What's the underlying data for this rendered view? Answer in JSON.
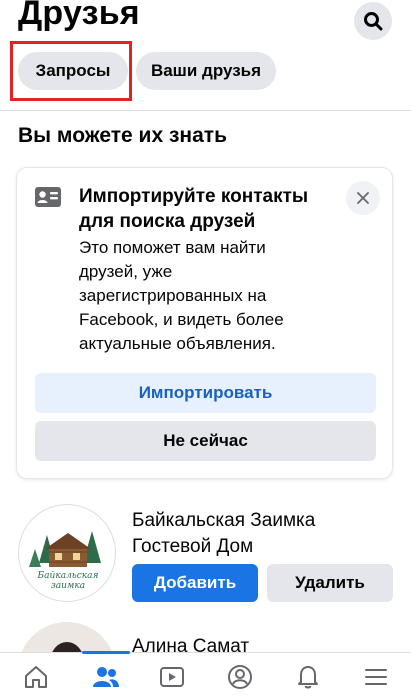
{
  "header": {
    "title": "Друзья",
    "search_icon": "search-icon"
  },
  "chips": {
    "requests": "Запросы",
    "your_friends": "Ваши друзья"
  },
  "section": {
    "title": "Вы можете их знать"
  },
  "import_card": {
    "icon": "contact-card-icon",
    "close_icon": "close-icon",
    "title_line1": "Импортируйте контакты",
    "title_line2": "для поиска друзей",
    "body_lines": [
      "Это поможет вам найти",
      "друзей, уже",
      "зарегистрированных на",
      "Facebook, и видеть более",
      "актуальные объявления."
    ],
    "import_button": "Импортировать",
    "later_button": "Не сейчас"
  },
  "suggestions": [
    {
      "name_line1": "Байкальская Заимка",
      "name_line2": "Гостевой Дом",
      "avatar_text_line1": "Байкальская",
      "avatar_text_line2": "заимка",
      "add_button": "Добавить",
      "remove_button": "Удалить"
    },
    {
      "name": "Алина Самат"
    }
  ],
  "tabbar": {
    "active_tab": "friends",
    "tabs": [
      {
        "id": "home",
        "icon": "home-icon"
      },
      {
        "id": "friends",
        "icon": "friends-icon"
      },
      {
        "id": "watch",
        "icon": "video-icon"
      },
      {
        "id": "profile",
        "icon": "profile-icon"
      },
      {
        "id": "notifications",
        "icon": "bell-icon"
      },
      {
        "id": "menu",
        "icon": "menu-icon"
      }
    ]
  },
  "colors": {
    "accent": "#1b74e4",
    "highlight_box": "#e02424"
  }
}
